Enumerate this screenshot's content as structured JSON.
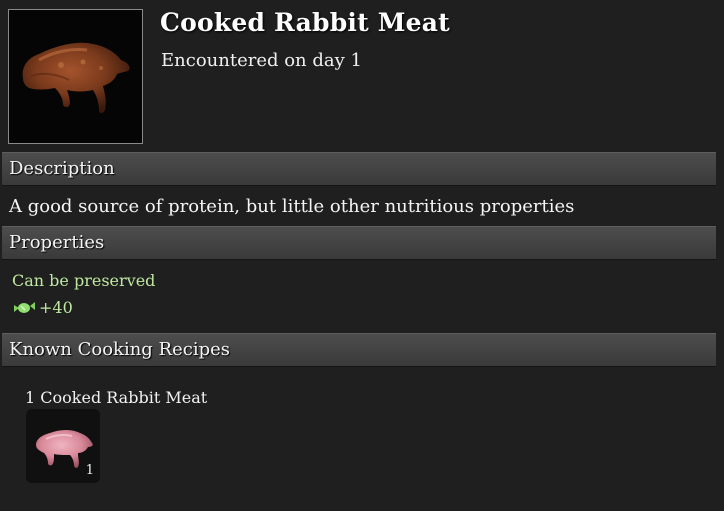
{
  "item": {
    "title": "Cooked Rabbit Meat",
    "encountered": "Encountered on day 1",
    "icon": "cooked-rabbit-meat-icon"
  },
  "sections": {
    "description": {
      "heading": "Description",
      "text": "A good source of protein, but little other nutritious properties"
    },
    "properties": {
      "heading": "Properties",
      "preserve": "Can be preserved",
      "stat_icon": "protein-candy-icon",
      "stat_value": "+40"
    },
    "recipes": {
      "heading": "Known Cooking Recipes",
      "items": [
        {
          "label": "1 Cooked Rabbit Meat",
          "count": "1",
          "icon": "raw-rabbit-meat-icon"
        }
      ]
    }
  },
  "colors": {
    "panel": "#1f1f1f",
    "header_bar": "#454545",
    "positive_text": "#bfe8a0"
  }
}
